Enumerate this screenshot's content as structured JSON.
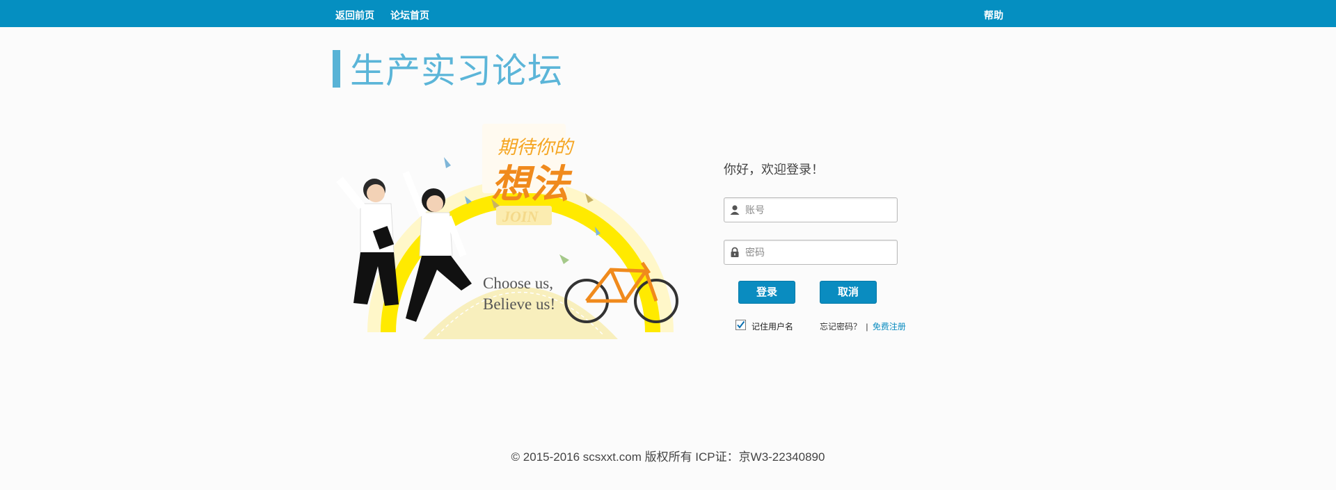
{
  "topbar": {
    "back_label": "返回前页",
    "forum_home_label": "论坛首页",
    "help_label": "帮助",
    "bg_color": "#058fc1"
  },
  "page_title": "生产实习论坛",
  "hero": {
    "headline_small": "期待你的",
    "headline_big": "想法",
    "join_text": "JOIN",
    "slogan_line1": "Choose us,",
    "slogan_line2": "Believe us!"
  },
  "login": {
    "welcome": "你好，欢迎登录！",
    "account_placeholder": "账号",
    "password_placeholder": "密码",
    "login_label": "登录",
    "cancel_label": "取消",
    "remember_label": "记住用户名",
    "remember_checked": true,
    "forgot_label": "忘记密码？",
    "separator": "|",
    "register_label": "免费注册",
    "accent_color": "#0a8cc0"
  },
  "footer": {
    "copyright": "© 2015-2016 scsxxt.com 版权所有 ICP证：京W3-22340890"
  }
}
